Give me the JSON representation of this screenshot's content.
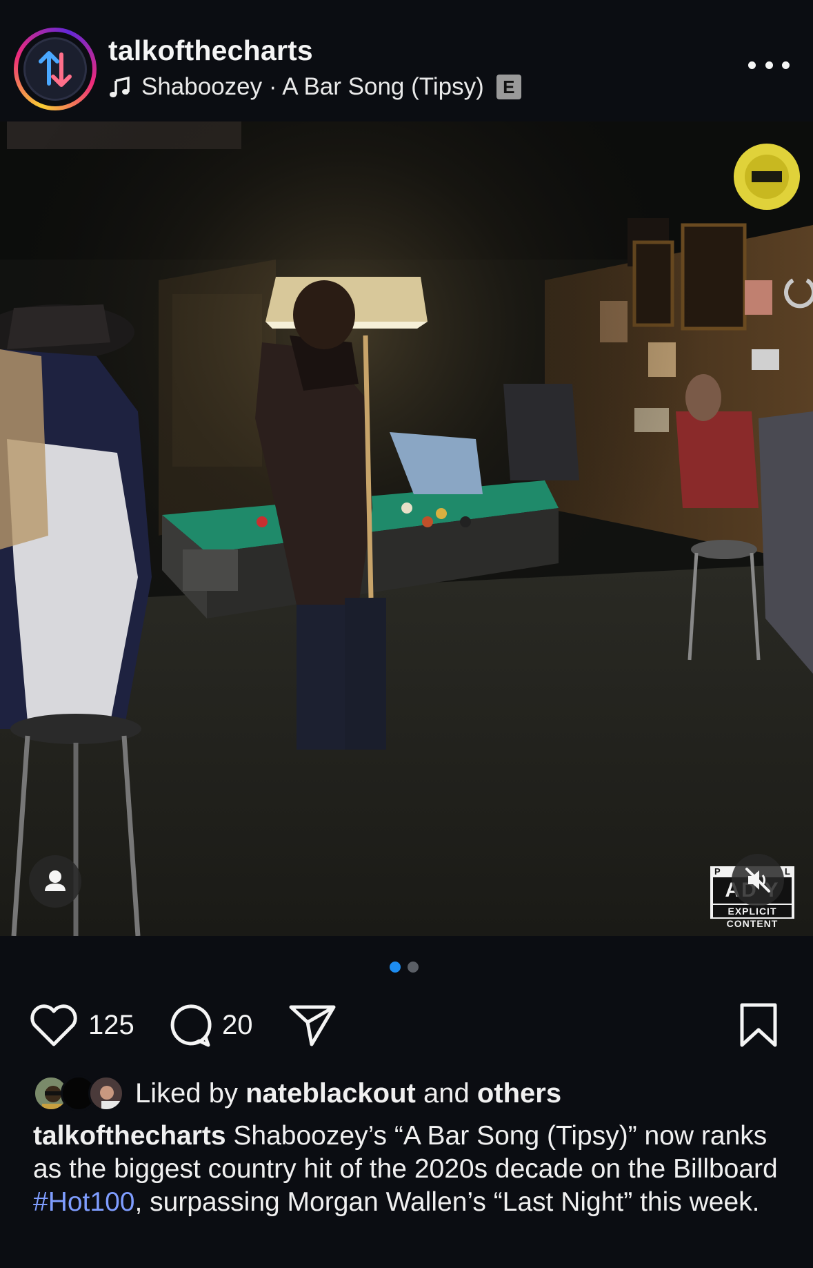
{
  "header": {
    "username": "talkofthecharts",
    "music_text": "Shaboozey · A Bar Song (Tipsy)",
    "explicit_badge": "E",
    "more_icon": "more-horizontal-icon"
  },
  "media": {
    "advisory_label": {
      "top_left": "P",
      "top_right": "L",
      "middle": "AD   Y",
      "bottom": "EXPLICIT CONTENT"
    },
    "mute_icon": "speaker-muted-icon",
    "tag_icon": "person-icon"
  },
  "carousel": {
    "count": 2,
    "active_index": 0
  },
  "actions": {
    "likes_count": "125",
    "comments_count": "20"
  },
  "liked_by": {
    "prefix": "Liked by",
    "user": "nateblackout",
    "and": "and",
    "others": "others"
  },
  "caption": {
    "username": "talkofthecharts",
    "text_before_tag": " Shaboozey’s “A Bar Song (Tipsy)” now ranks as the biggest country hit of the 2020s decade on the Billboard ",
    "hashtag": "#Hot100",
    "text_after_tag": ", surpassing Morgan Wallen’s “Last Night” this week."
  },
  "colors": {
    "background": "#0b0d12",
    "hashtag": "#7f9dff",
    "active_dot": "#1d8cf0",
    "inactive_dot": "#5b5f66"
  }
}
